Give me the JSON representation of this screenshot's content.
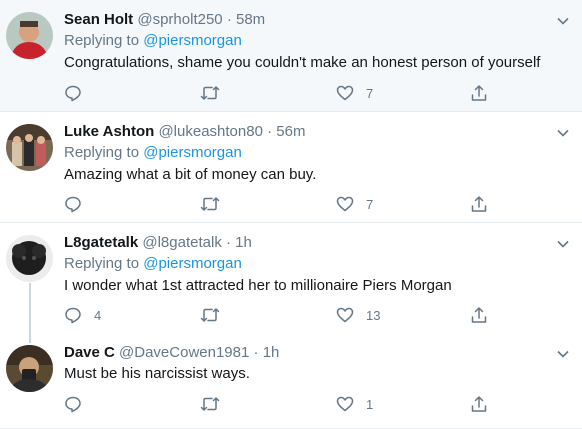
{
  "tweets": [
    {
      "name": "Sean Holt",
      "handle": "@sprholt250",
      "sep": "·",
      "time": "58m",
      "replying_prefix": "Replying to",
      "replying_to": "@piersmorgan",
      "text": "Congratulations, shame you couldn't make an honest person of yourself",
      "reply_count": "",
      "retweet_count": "",
      "like_count": "7"
    },
    {
      "name": "Luke Ashton",
      "handle": "@lukeashton80",
      "sep": "·",
      "time": "56m",
      "replying_prefix": "Replying to",
      "replying_to": "@piersmorgan",
      "text": "Amazing what a bit of money can buy.",
      "reply_count": "",
      "retweet_count": "",
      "like_count": "7"
    },
    {
      "name": "L8gatetalk",
      "handle": "@l8gatetalk",
      "sep": "·",
      "time": "1h",
      "replying_prefix": "Replying to",
      "replying_to": "@piersmorgan",
      "text": "I wonder what 1st attracted her to millionaire Piers Morgan",
      "reply_count": "4",
      "retweet_count": "",
      "like_count": "13"
    },
    {
      "name": "Dave C",
      "handle": "@DaveCowen1981",
      "sep": "·",
      "time": "1h",
      "replying_prefix": "",
      "replying_to": "",
      "text": "Must be his narcissist ways.",
      "reply_count": "",
      "retweet_count": "",
      "like_count": "1"
    }
  ],
  "icons": {
    "reply": "reply-icon",
    "retweet": "retweet-icon",
    "like": "heart-icon",
    "share": "share-icon",
    "caret": "chevron-down-icon"
  },
  "colors": {
    "text_primary": "#14171a",
    "text_secondary": "#657786",
    "link": "#1b95e0",
    "divider": "#e6ecf0",
    "highlight_bg": "#f5f8fa"
  }
}
